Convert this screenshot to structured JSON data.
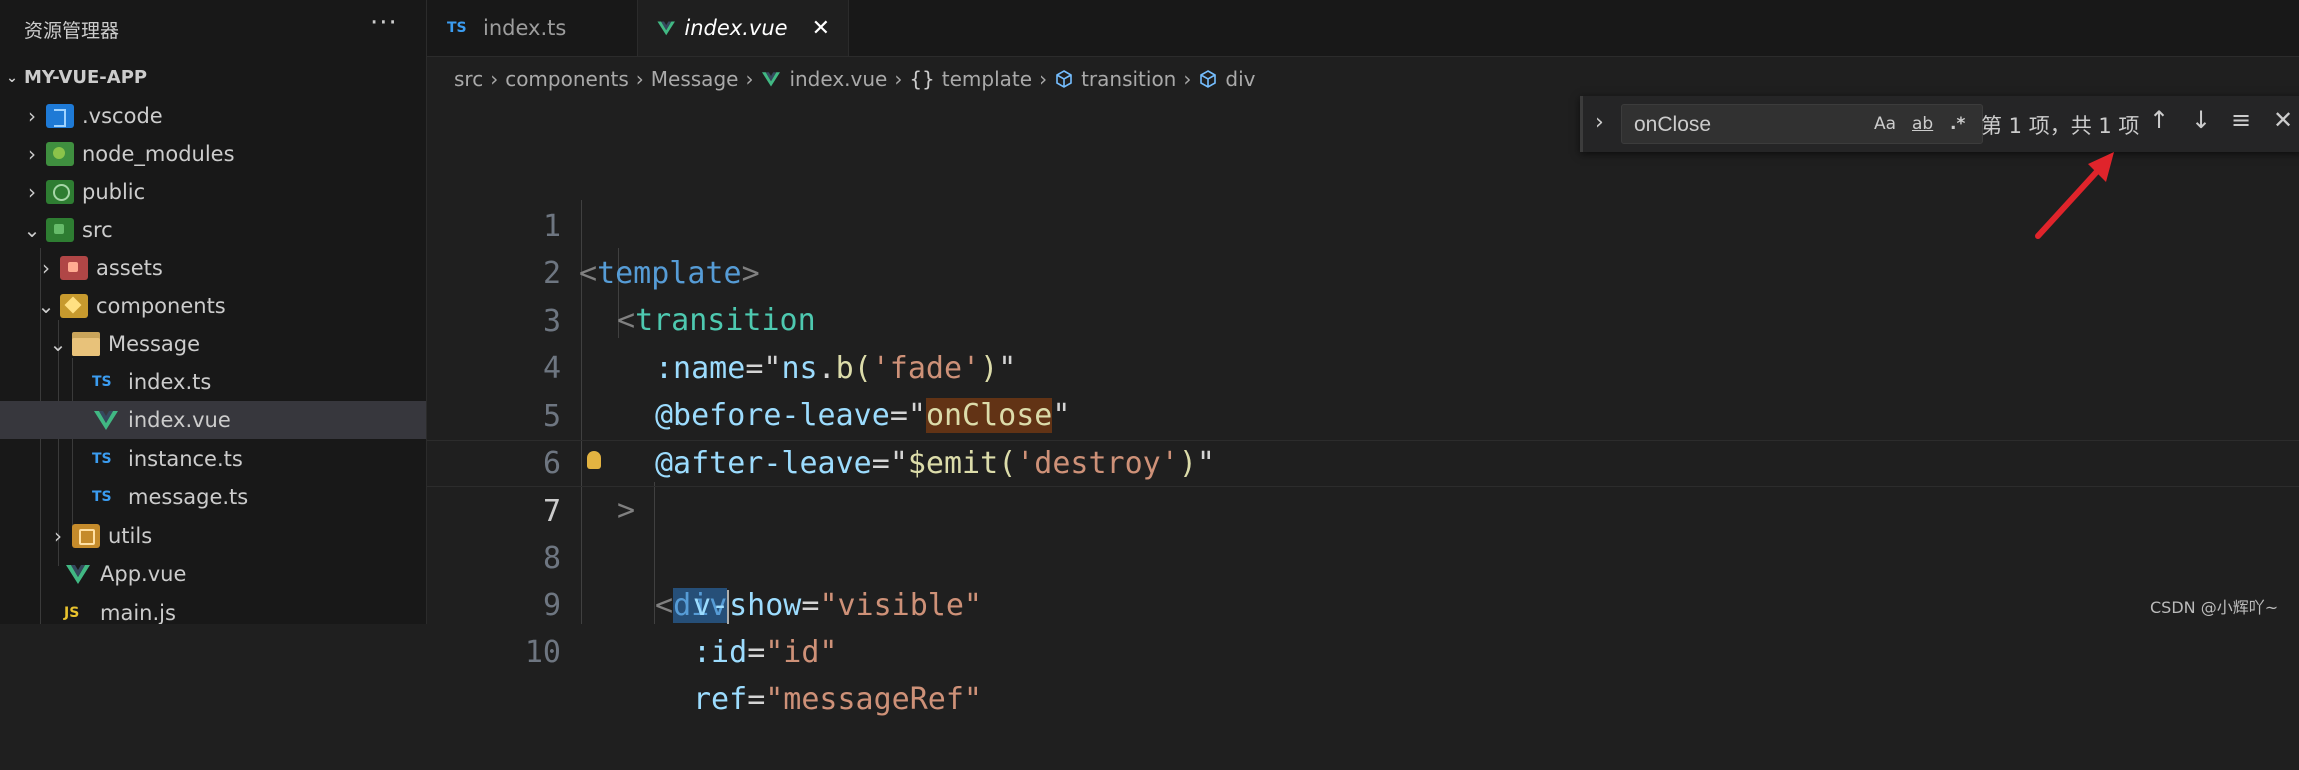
{
  "sidebar": {
    "title": "资源管理器",
    "more": "···",
    "project": "MY-VUE-APP",
    "items": [
      {
        "label": ".vscode",
        "icon": "vscode-folder-icon"
      },
      {
        "label": "node_modules",
        "icon": "node-modules-folder-icon"
      },
      {
        "label": "public",
        "icon": "public-folder-icon"
      },
      {
        "label": "src",
        "icon": "src-folder-icon"
      },
      {
        "label": "assets",
        "icon": "assets-folder-icon"
      },
      {
        "label": "components",
        "icon": "components-folder-icon"
      },
      {
        "label": "Message",
        "icon": "folder-open-icon"
      },
      {
        "label": "index.ts",
        "icon": "ts-file-icon",
        "badge": "TS"
      },
      {
        "label": "index.vue",
        "icon": "vue-file-icon"
      },
      {
        "label": "instance.ts",
        "icon": "ts-file-icon",
        "badge": "TS"
      },
      {
        "label": "message.ts",
        "icon": "ts-file-icon",
        "badge": "TS"
      },
      {
        "label": "utils",
        "icon": "utils-folder-icon"
      },
      {
        "label": "App.vue",
        "icon": "vue-file-icon"
      },
      {
        "label": "main.js",
        "icon": "js-file-icon",
        "badge": "JS"
      }
    ]
  },
  "tabs": [
    {
      "label": "index.ts",
      "badge": "TS"
    },
    {
      "label": "index.vue",
      "close": "✕"
    }
  ],
  "breadcrumb": [
    "src",
    "components",
    "Message",
    "index.vue",
    "template",
    "transition",
    "div"
  ],
  "breadcrumb_prefix": "{}",
  "find": {
    "value": "onClose",
    "match_case": "Aa",
    "whole_word": "ab",
    "regex": ".*",
    "result": "第 1 项，共 1 项"
  },
  "editor": {
    "current_line": 7,
    "lines": [
      {
        "n": "1"
      },
      {
        "n": "2"
      },
      {
        "n": "3"
      },
      {
        "n": "4"
      },
      {
        "n": "5"
      },
      {
        "n": "6"
      },
      {
        "n": "7"
      },
      {
        "n": "8"
      },
      {
        "n": "9"
      },
      {
        "n": "10"
      }
    ],
    "tokens": {
      "l1": [
        "<",
        "template",
        ">"
      ],
      "l2": [
        "<",
        "transition"
      ],
      "l3": [
        ":name",
        "=",
        "\"",
        "ns",
        ".",
        "b",
        "(",
        "'fade'",
        ")",
        "\""
      ],
      "l4": [
        "@before-leave",
        "=",
        "\"",
        "onClose",
        "\""
      ],
      "l5": [
        "@after-leave",
        "=",
        "\"",
        "$emit",
        "(",
        "'destroy'",
        ")",
        "\""
      ],
      "l6": [
        ">"
      ],
      "l7": [
        "<",
        "div"
      ],
      "l8": [
        "v-show",
        "=",
        "\"visible\""
      ],
      "l9": [
        ":id",
        "=",
        "\"id\""
      ],
      "l10": [
        "ref",
        "=",
        "\"messageRef\""
      ]
    }
  },
  "watermark": "CSDN @小辉吖~",
  "colors": {
    "background": "#1f1f1f",
    "sidebar": "#181818",
    "selection": "#37373d",
    "find_highlight": "#623315",
    "arrow": "#e0242b"
  }
}
